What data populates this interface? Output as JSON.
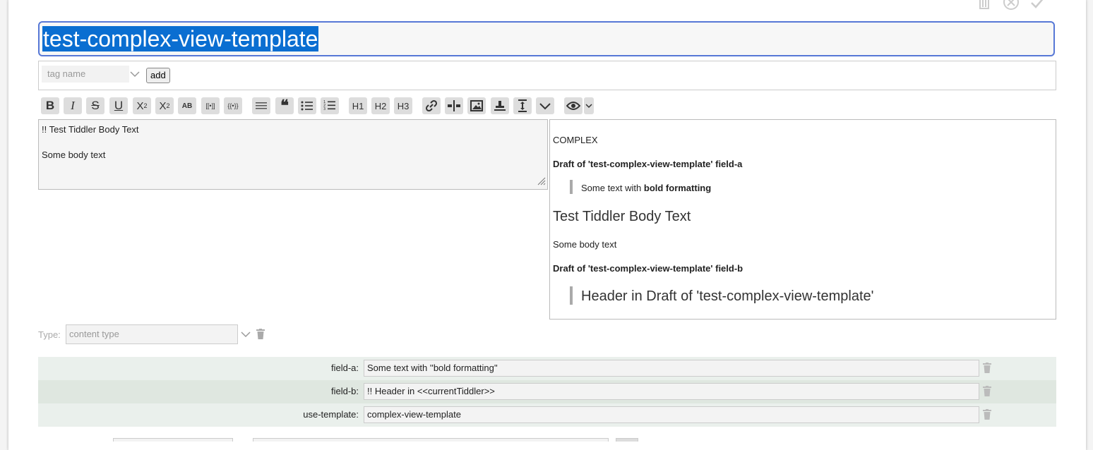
{
  "title": "test-complex-view-template",
  "top_actions": [
    "delete-icon",
    "cancel-icon",
    "done-icon"
  ],
  "tags": {
    "placeholder": "tag name",
    "add_label": "add"
  },
  "toolbar": {
    "bold": "B",
    "italic": "I",
    "strike": "S",
    "underline": "U",
    "superscript": "X",
    "sup_small": "2",
    "subscript": "X",
    "sub_small": "2",
    "smallcaps": "AB",
    "link_wiki": "[[•]]",
    "transclude": "{{•}}",
    "quote": "❝",
    "h1": "H1",
    "h2": "H2",
    "h3": "H3"
  },
  "editor": {
    "lines": [
      "!! Test Tiddler Body Text",
      "",
      "Some body text"
    ]
  },
  "preview": {
    "complex": "COMPLEX",
    "field_a_heading": "Draft of 'test-complex-view-template' field-a",
    "field_a_prefix": "Some text with ",
    "field_a_bold": "bold formatting",
    "body_heading": "Test Tiddler Body Text",
    "body_text": "Some body text",
    "field_b_heading": "Draft of 'test-complex-view-template' field-b",
    "field_b_quote": "Header in Draft of 'test-complex-view-template'"
  },
  "type": {
    "label": "Type:",
    "placeholder": "content type"
  },
  "fields": [
    {
      "name": "field-a:",
      "value": "Some text with ''bold formatting''"
    },
    {
      "name": "field-b:",
      "value": "!! Header in <<currentTiddler>>"
    },
    {
      "name": "use-template:",
      "value": "complex-view-template"
    }
  ]
}
